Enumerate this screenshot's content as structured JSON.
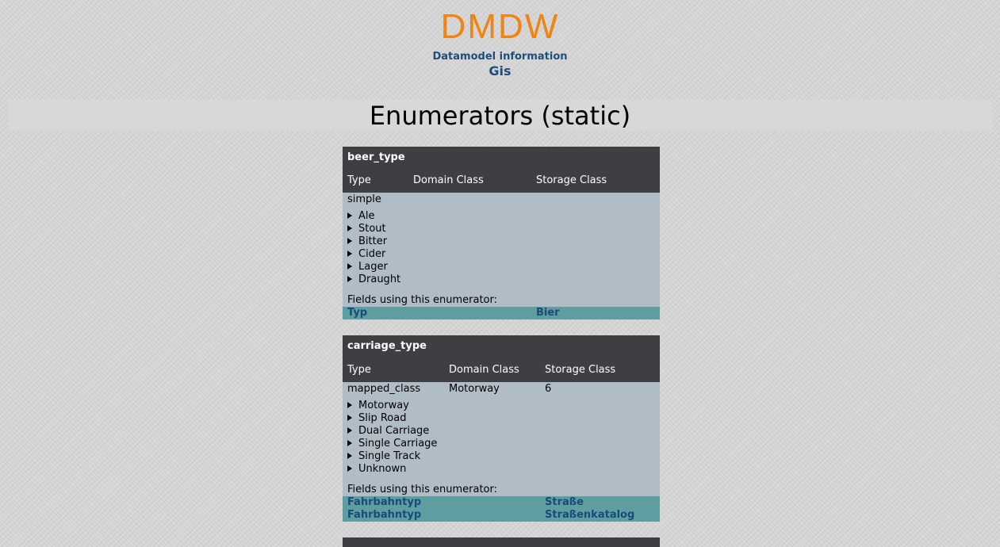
{
  "header": {
    "logo": "DMDW",
    "subtitle": "Datamodel information",
    "model_name": "Gis"
  },
  "page_title": "Enumerators (static)",
  "columns": {
    "type": "Type",
    "domain_class": "Domain Class",
    "storage_class": "Storage Class"
  },
  "fields_label": "Fields using this enumerator:",
  "enumerators": [
    {
      "name": "beer_type",
      "type": "simple",
      "domain_class": "",
      "storage_class": "",
      "values": [
        "Ale",
        "Stout",
        "Bitter",
        "Cider",
        "Lager",
        "Draught"
      ],
      "fields": [
        {
          "field": "Typ",
          "table": "Bier"
        }
      ]
    },
    {
      "name": "carriage_type",
      "type": "mapped_class",
      "domain_class": "Motorway",
      "storage_class": "6",
      "values": [
        "Motorway",
        "Slip Road",
        "Dual Carriage",
        "Single Carriage",
        "Single Track",
        "Unknown"
      ],
      "fields": [
        {
          "field": "Fahrbahntyp",
          "table": "Straße"
        },
        {
          "field": "Fahrbahntyp",
          "table": "Straßenkatalog"
        }
      ]
    }
  ]
}
